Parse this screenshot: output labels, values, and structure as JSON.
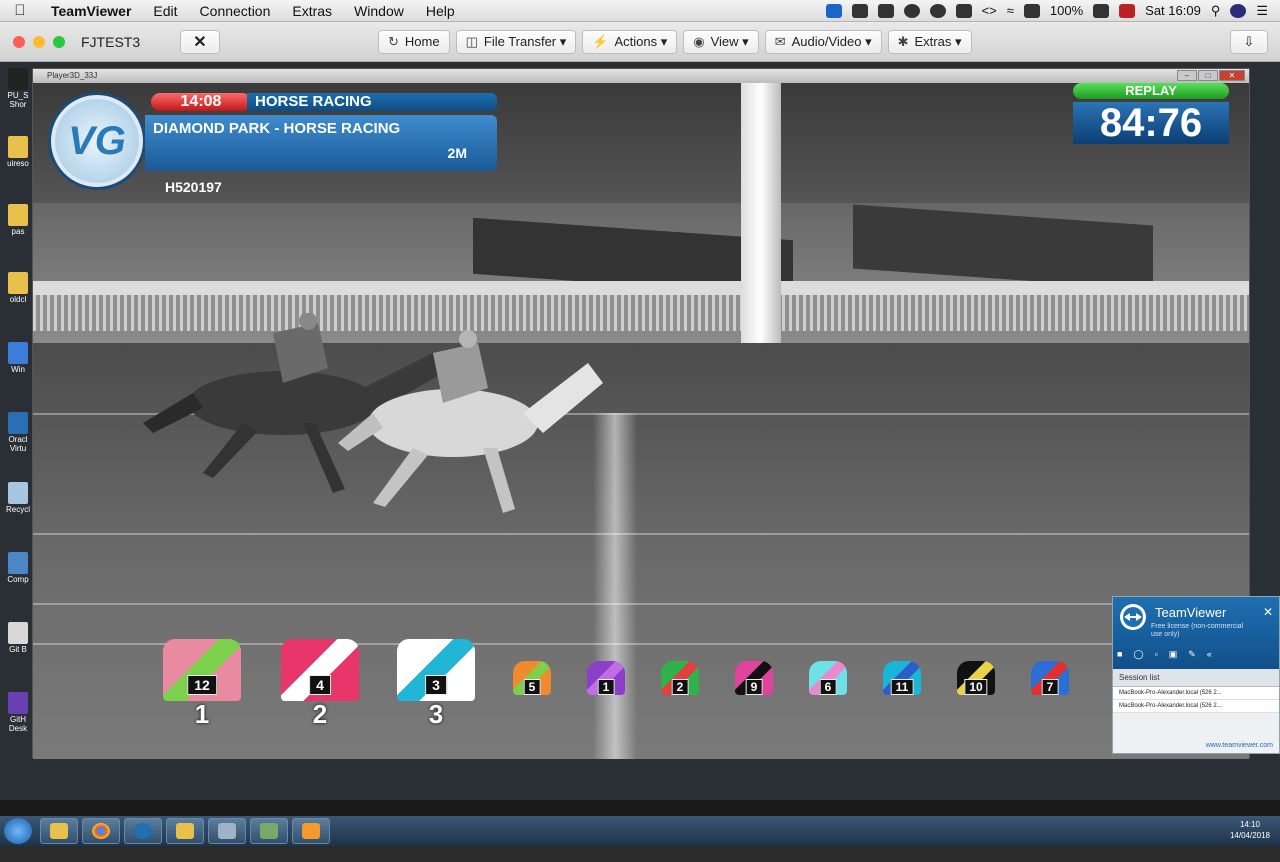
{
  "menubar": {
    "app_name": "TeamViewer",
    "items": [
      "Edit",
      "Connection",
      "Extras",
      "Window",
      "Help"
    ],
    "battery": "100%",
    "clock": "Sat 16:09"
  },
  "tv_toolbar": {
    "tab_title": "FJTEST3",
    "close_label": "✕",
    "home": "Home",
    "file_transfer": "File Transfer ▾",
    "actions": "Actions ▾",
    "view": "View ▾",
    "audio_video": "Audio/Video ▾",
    "extras": "Extras ▾",
    "download_icon": "⇩"
  },
  "desktop_icons": [
    "PU_S Shor",
    "uireso",
    "pas",
    "oldcl",
    "Win",
    "Oracl Virtu",
    "Recycl",
    "Comp",
    "Git B",
    "GitH Desk"
  ],
  "player": {
    "window_title": "Player3D_33J"
  },
  "race": {
    "time": "14:08",
    "type": "HORSE RACING",
    "venue": "DIAMOND PARK - HORSE RACING",
    "distance": "2M",
    "race_id": "H520197",
    "replay_label": "REPLAY",
    "timer": "84:76"
  },
  "silks": [
    {
      "num": "12",
      "place": "1",
      "color": "#e88aa0",
      "accent": "#7bd14b"
    },
    {
      "num": "4",
      "place": "2",
      "color": "#e8356a",
      "accent": "#ffffff"
    },
    {
      "num": "3",
      "place": "3",
      "color": "#ffffff",
      "accent": "#21b6d6"
    },
    {
      "num": "5",
      "place": "",
      "color": "#f08a2e",
      "accent": "#7dd04a"
    },
    {
      "num": "1",
      "place": "",
      "color": "#8e3fc9",
      "accent": "#c16de6"
    },
    {
      "num": "2",
      "place": "",
      "color": "#2fb24a",
      "accent": "#e04040"
    },
    {
      "num": "9",
      "place": "",
      "color": "#e042a0",
      "accent": "#111111"
    },
    {
      "num": "6",
      "place": "",
      "color": "#6fe0e6",
      "accent": "#e88ad0"
    },
    {
      "num": "11",
      "place": "",
      "color": "#19b6d8",
      "accent": "#2a5fc9"
    },
    {
      "num": "10",
      "place": "",
      "color": "#111111",
      "accent": "#e8d24a"
    },
    {
      "num": "7",
      "place": "",
      "color": "#2a6fd6",
      "accent": "#e03030"
    }
  ],
  "tv_popup": {
    "brand": "TeamViewer",
    "license": "Free license (non-commercial use only)",
    "session_list": "Session list",
    "sessions": [
      "MacBook-Pro-Alexander.local (526 2...",
      "MacBook-Pro-Alexander.local (526 2..."
    ],
    "link": "www.teamviewer.com"
  },
  "taskbar": {
    "time": "14:10",
    "date": "14/04/2018"
  }
}
